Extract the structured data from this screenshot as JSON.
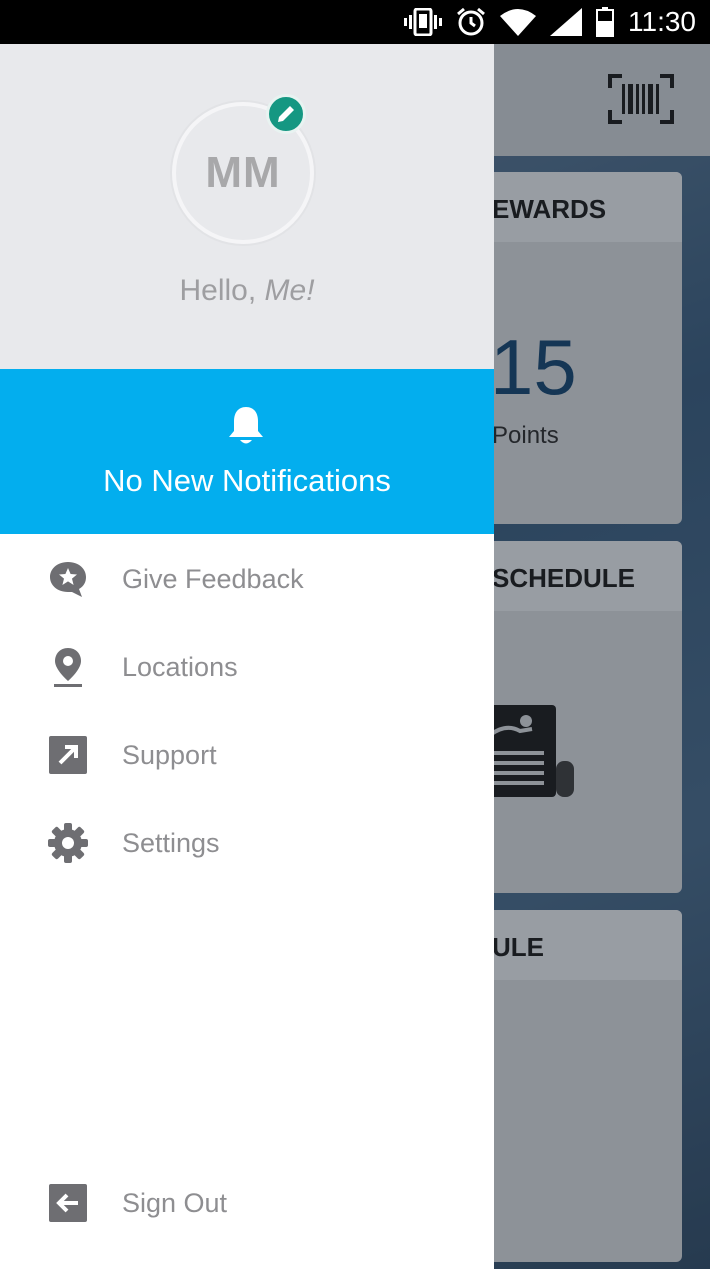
{
  "status_bar": {
    "time": "11:30"
  },
  "background": {
    "cards": [
      {
        "title": "EWARDS",
        "value": "15",
        "unit": "Points"
      },
      {
        "title": "SCHEDULE"
      },
      {
        "title": "ULE"
      }
    ]
  },
  "drawer": {
    "profile": {
      "initials": "MM",
      "greeting": "Hello,",
      "name": "Me!"
    },
    "notifications": {
      "text": "No New Notifications"
    },
    "menu": [
      {
        "label": "Give Feedback",
        "icon": "feedback-star-icon"
      },
      {
        "label": "Locations",
        "icon": "location-pin-icon"
      },
      {
        "label": "Support",
        "icon": "external-link-icon"
      },
      {
        "label": "Settings",
        "icon": "gear-icon"
      }
    ],
    "sign_out": {
      "label": "Sign Out",
      "icon": "sign-out-icon"
    }
  },
  "colors": {
    "notification_bg": "#03aeee",
    "edit_badge": "#159782",
    "menu_text": "#8e8e91",
    "menu_icon": "#6e6e72"
  }
}
